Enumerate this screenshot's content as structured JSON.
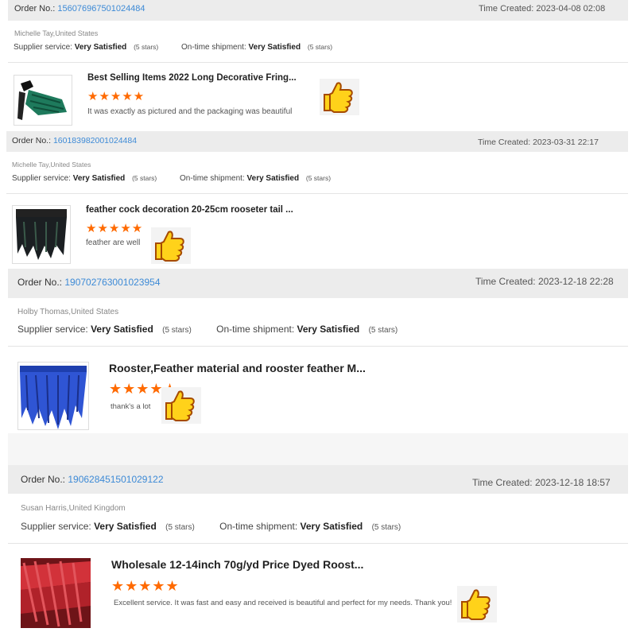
{
  "colors": {
    "header_bg": "#ececec",
    "link": "#3d8ad6",
    "star": "#ff6a00"
  },
  "labels": {
    "order_no": "Order No.:",
    "time_created": "Time Created:",
    "supplier_service": "Supplier service:",
    "ontime_shipment": "On-time shipment:"
  },
  "reviews": [
    {
      "order_no": "156076967501024484",
      "time_created": "2023-04-08 02:08",
      "buyer": "Michelle Tay,United States",
      "supplier_rating": "Very Satisfied",
      "supplier_stars": "(5 stars)",
      "shipment_rating": "Very Satisfied",
      "shipment_stars": "(5 stars)",
      "product_title": "Best Selling Items 2022 Long Decorative Fring...",
      "stars": "★★★★★",
      "comment": "It was exactly as pictured and the packaging was beautiful",
      "image_icon": "green-feather-image",
      "thumb_icon": "thumbs-up-icon"
    },
    {
      "order_no": "160183982001024484",
      "time_created": "2023-03-31 22:17",
      "buyer": "Michelle Tay,United States",
      "supplier_rating": "Very Satisfied",
      "supplier_stars": "(5 stars)",
      "shipment_rating": "Very Satisfied",
      "shipment_stars": "(5 stars)",
      "product_title": "feather cock decoration 20-25cm rooseter tail ...",
      "stars": "★★★★★",
      "comment": "feather are well",
      "image_icon": "black-feather-image",
      "thumb_icon": "thumbs-up-icon"
    },
    {
      "order_no": "190702763001023954",
      "time_created": "2023-12-18 22:28",
      "buyer": "Holby Thomas,United States",
      "supplier_rating": "Very Satisfied",
      "supplier_stars": "(5 stars)",
      "shipment_rating": "Very Satisfied",
      "shipment_stars": "(5 stars)",
      "product_title": "Rooster,Feather material and rooster feather M...",
      "stars": "★★★★★",
      "comment": "thank's a lot",
      "image_icon": "blue-feather-image",
      "thumb_icon": "thumbs-up-icon"
    },
    {
      "order_no": "190628451501029122",
      "time_created": "2023-12-18 18:57",
      "buyer": "Susan Harris,United Kingdom",
      "supplier_rating": "Very Satisfied",
      "supplier_stars": "(5 stars)",
      "shipment_rating": "Very Satisfied",
      "shipment_stars": "(5 stars)",
      "product_title": "Wholesale 12-14inch 70g/yd Price Dyed Roost...",
      "stars": "★★★★★",
      "comment": "Excellent service. It was fast and easy and received is beautiful and perfect for my needs. Thank you!",
      "image_icon": "red-feather-image",
      "thumb_icon": "thumbs-up-icon"
    }
  ]
}
